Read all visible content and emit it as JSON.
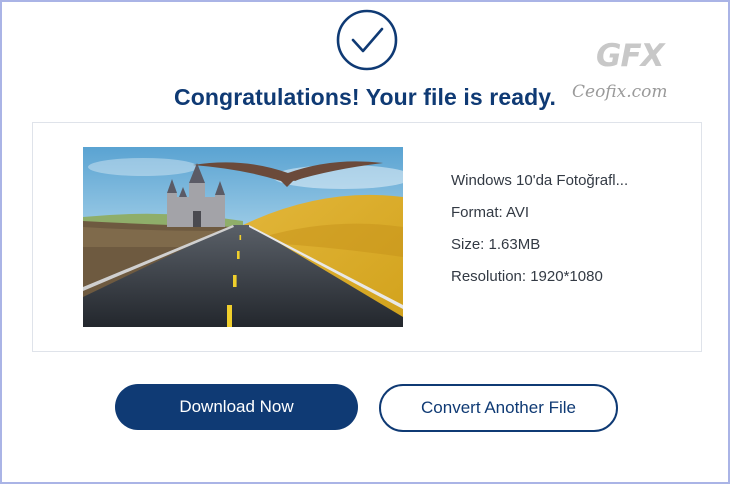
{
  "header": {
    "title": "Congratulations! Your file is ready."
  },
  "watermark": {
    "logo_text": "GFX",
    "site_text": "Ceofix.com"
  },
  "file": {
    "name": "Windows 10'da Fotoğrafl...",
    "format": "Format: AVI",
    "size": "Size: 1.63MB",
    "resolution": "Resolution: 1920*1080"
  },
  "actions": {
    "download_label": "Download Now",
    "convert_label": "Convert Another File"
  },
  "colors": {
    "accent": "#0f3a74",
    "frame_border": "#aab4e6"
  },
  "icons": {
    "success": "check-circle-icon",
    "thumbnail": "video-thumbnail"
  }
}
